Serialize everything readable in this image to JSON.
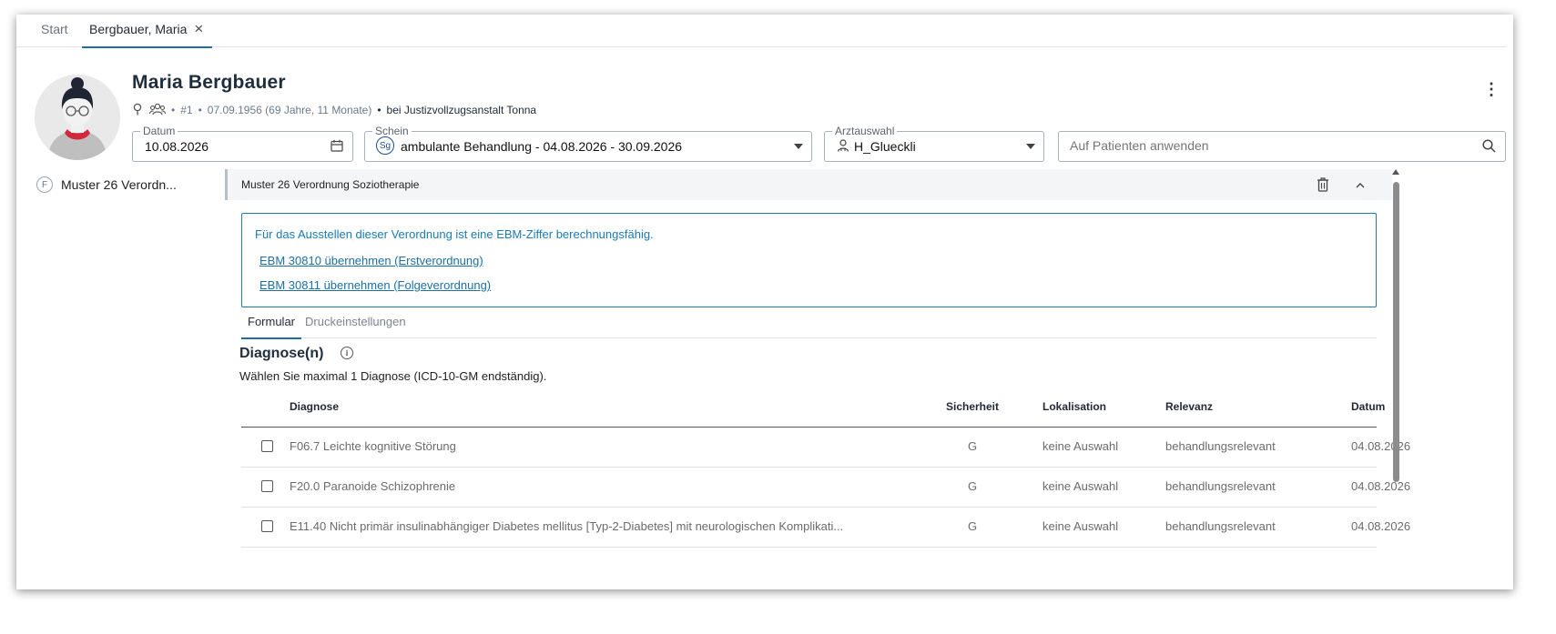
{
  "tabs": {
    "start": "Start",
    "patient": "Bergbauer, Maria"
  },
  "patient": {
    "name": "Maria Bergbauer",
    "number": "#1",
    "dob_age": "07.09.1956 (69 Jahre, 11 Monate)",
    "location": "bei Justizvollzugsanstalt Tonna"
  },
  "fields": {
    "datum": {
      "label": "Datum",
      "value": "10.08.2026"
    },
    "schein": {
      "label": "Schein",
      "badge": "Sg",
      "value": "ambulante Behandlung - 04.08.2026 - 30.09.2026"
    },
    "arzt": {
      "label": "Arztauswahl",
      "value": "H_Glueckli"
    },
    "apply": {
      "placeholder": "Auf Patienten anwenden"
    }
  },
  "nav": {
    "items": [
      {
        "badge": "F",
        "label": "Muster 26 Verordn..."
      }
    ]
  },
  "form": {
    "title": "Muster 26 Verordnung Soziotherapie",
    "info_text": "Für das Ausstellen dieser Verordnung ist eine EBM-Ziffer berechnungsfähig.",
    "link1": "EBM 30810 übernehmen (Erstverordnung)",
    "link2": "EBM 30811 übernehmen (Folgeverordnung)",
    "tab_formular": "Formular",
    "tab_druck": "Druckeinstellungen",
    "section_title": "Diagnose(n)",
    "section_hint": "Wählen Sie maximal 1 Diagnose (ICD-10-GM endständig)."
  },
  "table": {
    "headers": {
      "diagnose": "Diagnose",
      "sicherheit": "Sicherheit",
      "lokalisation": "Lokalisation",
      "relevanz": "Relevanz",
      "datum": "Datum"
    },
    "rows": [
      {
        "diagnose": "F06.7 Leichte kognitive Störung",
        "sicherheit": "G",
        "lokalisation": "keine Auswahl",
        "relevanz": "behandlungsrelevant",
        "datum": "04.08.2026"
      },
      {
        "diagnose": "F20.0 Paranoide Schizophrenie",
        "sicherheit": "G",
        "lokalisation": "keine Auswahl",
        "relevanz": "behandlungsrelevant",
        "datum": "04.08.2026"
      },
      {
        "diagnose": "E11.40 Nicht primär insulinabhängiger Diabetes mellitus [Typ-2-Diabetes] mit neurologischen Komplikati...",
        "sicherheit": "G",
        "lokalisation": "keine Auswahl",
        "relevanz": "behandlungsrelevant",
        "datum": "04.08.2026"
      }
    ]
  },
  "colors": {
    "accent": "#1d6fa3",
    "info_border": "#1b7bb5",
    "header_title": "#1f2d3d"
  },
  "icons": {
    "pin": "map-pin-icon",
    "group": "people-group-icon",
    "calendar": "calendar-icon",
    "search": "search-icon",
    "user": "person-icon",
    "trash": "trash-icon",
    "collapse": "chevron-up-icon",
    "more": "kebab-menu-icon",
    "info": "info-icon",
    "close": "close-icon"
  }
}
